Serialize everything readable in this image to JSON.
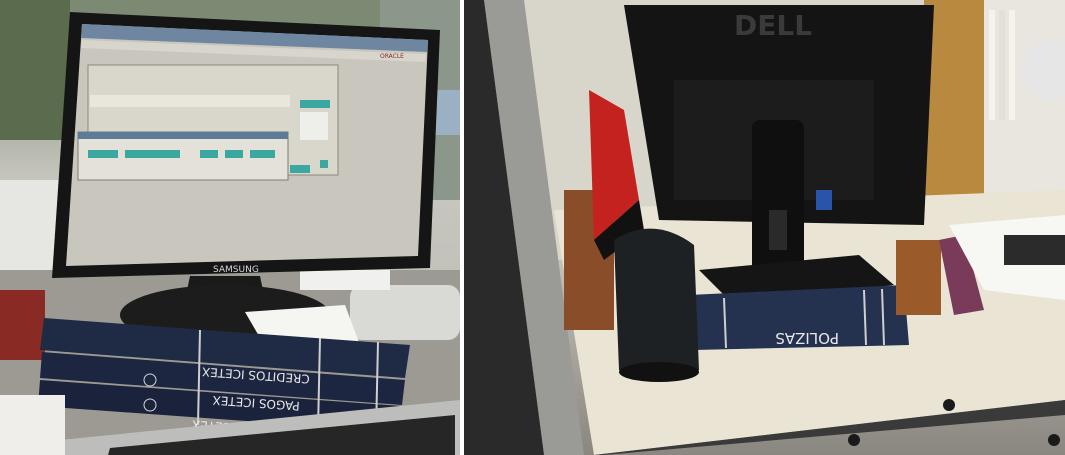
{
  "left_photo": {
    "monitor_brand": "SAMSUNG",
    "screen_header": "ORACLE",
    "books": [
      {
        "spine_label": "CREDITOS ICETEX"
      },
      {
        "spine_label": "PAGOS ICETEX"
      },
      {
        "spine_label": "CREDITOS ICETEX"
      }
    ]
  },
  "right_photo": {
    "monitor_brand": "DELL",
    "book_spine": "POLIZAS"
  },
  "colors": {
    "screen_bg": "#c9c7bd",
    "screen_accent": "#3aa8a0",
    "book_blue": "#1f2a44",
    "monitor_black": "#141414",
    "desk_cream": "#e9e4d3"
  }
}
